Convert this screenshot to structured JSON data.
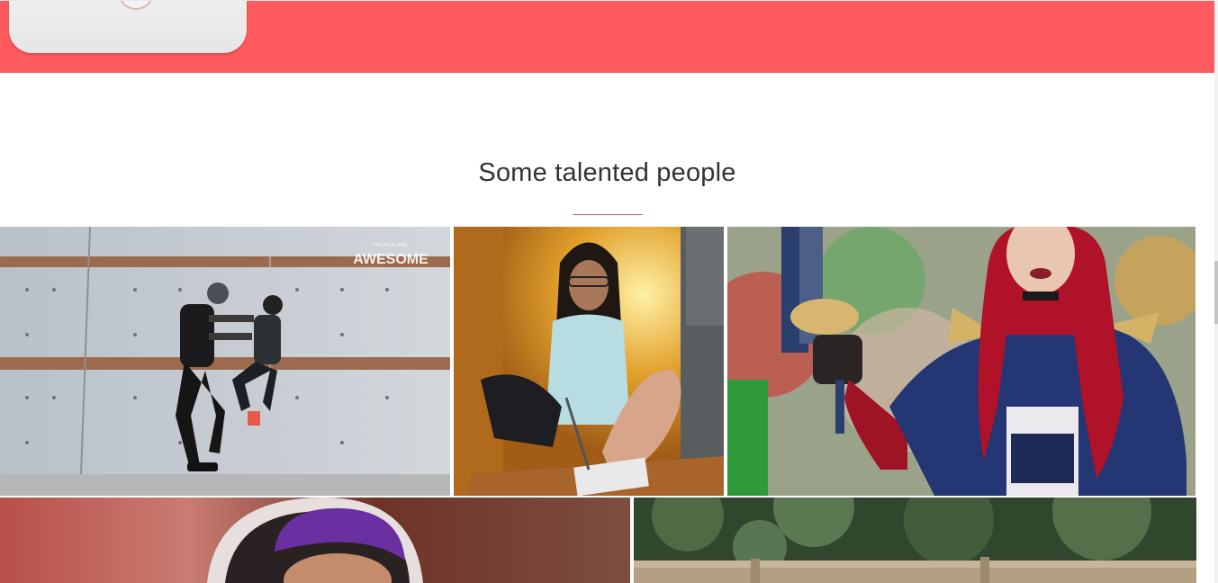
{
  "banner": {
    "color": "#ff5b5f"
  },
  "section": {
    "title": "Some talented people",
    "accent_color": "#ff5b5f"
  },
  "gallery": {
    "tiles": [
      {
        "id": "wall-jump",
        "watermark": "AWESOME",
        "watermark_sub": "PEOPLE ARE"
      },
      {
        "id": "foot-drawing"
      },
      {
        "id": "cosplay-redhead"
      },
      {
        "id": "purple-hair-hood"
      },
      {
        "id": "forest-fence"
      }
    ]
  }
}
